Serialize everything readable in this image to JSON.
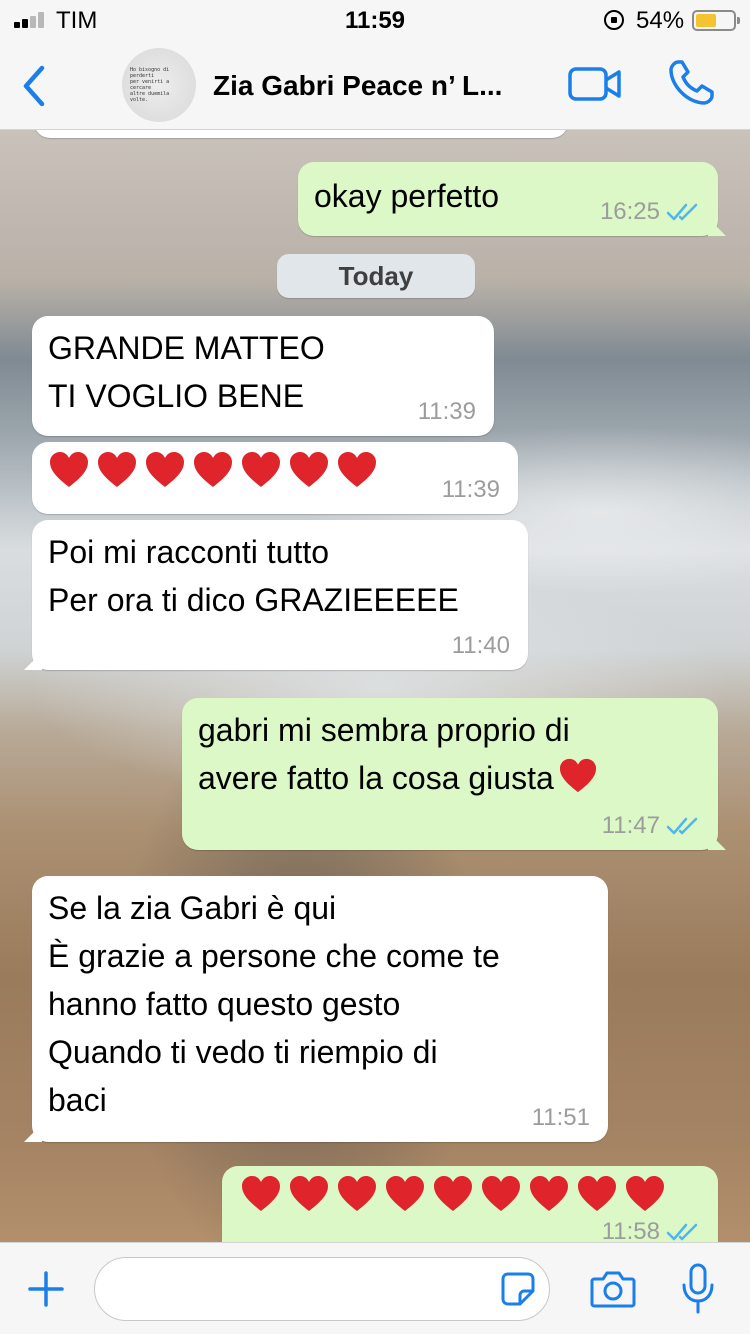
{
  "status_bar": {
    "carrier": "TIM",
    "time": "11:59",
    "battery_percent": "54%",
    "signal_bars": 2,
    "battery_level": 0.54
  },
  "header": {
    "back_icon": "chevron-left-icon",
    "avatar_lines": [
      "Ho bisogno di perderti",
      "per venirti a cercare",
      "altre duemila volte."
    ],
    "title": "Zia Gabri Peace n’ L...",
    "video_icon": "video-camera-icon",
    "call_icon": "phone-icon"
  },
  "chat": {
    "date_separator": "Today",
    "messages": [
      {
        "direction": "out",
        "text": "okay perfetto",
        "time": "16:25",
        "read": true
      },
      {
        "direction": "in",
        "text": "GRANDE MATTEO\nTI VOGLIO BENE",
        "time": "11:39"
      },
      {
        "direction": "in",
        "emoji": "❤️",
        "emoji_count": 7,
        "time": "11:39"
      },
      {
        "direction": "in",
        "text": "Poi mi racconti tutto\nPer ora ti dico GRAZIEEEEE",
        "time": "11:40"
      },
      {
        "direction": "out",
        "text": "gabri mi sembra proprio di\navere fatto la cosa giusta",
        "trailing_emoji": "❤️",
        "time": "11:47",
        "read": true
      },
      {
        "direction": "in",
        "text": "Se la zia Gabri è qui\nÈ grazie a persone che come te\nhanno fatto questo gesto\nQuando ti vedo ti riempio di\nbaci",
        "time": "11:51"
      },
      {
        "direction": "out",
        "emoji": "❤️",
        "emoji_count": 9,
        "time": "11:58",
        "read": true
      }
    ]
  },
  "input_bar": {
    "attach_icon": "plus-icon",
    "message_value": "",
    "sticker_icon": "sticker-icon",
    "camera_icon": "camera-icon",
    "mic_icon": "microphone-icon"
  },
  "colors": {
    "accent": "#1a7fe8",
    "outgoing_bubble": "#dcf8c6",
    "incoming_bubble": "#ffffff",
    "read_ticks": "#4fb6ec",
    "heart": "#e0242c"
  }
}
